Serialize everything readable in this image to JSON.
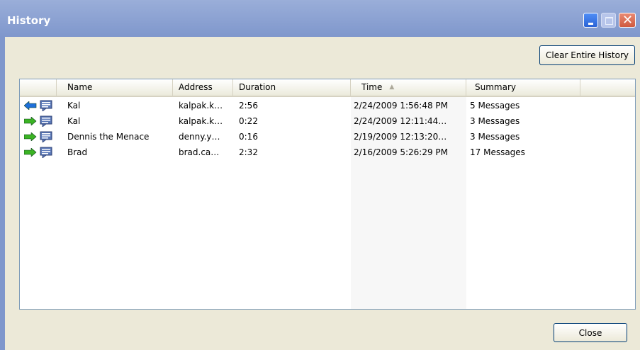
{
  "window": {
    "title": "History"
  },
  "toolbar": {
    "clear_label": "Clear Entire History"
  },
  "table": {
    "columns": [
      "Name",
      "Address",
      "Duration",
      "Time",
      "Summary"
    ],
    "sort_column": "Time",
    "rows": [
      {
        "direction": "incoming",
        "direction_icon": "blue-left-arrow-icon",
        "name": "Kal",
        "address": "kalpak.k…",
        "duration": "2:56",
        "time": "2/24/2009 1:56:48 PM",
        "summary": "5 Messages"
      },
      {
        "direction": "outgoing",
        "direction_icon": "green-right-arrow-icon",
        "name": "Kal",
        "address": "kalpak.k…",
        "duration": "0:22",
        "time": "2/24/2009 12:11:44…",
        "summary": "3 Messages"
      },
      {
        "direction": "outgoing",
        "direction_icon": "green-right-arrow-icon",
        "name": "Dennis the Menace",
        "address": "denny.y…",
        "duration": "0:16",
        "time": "2/19/2009 12:13:20…",
        "summary": "3 Messages"
      },
      {
        "direction": "outgoing",
        "direction_icon": "green-right-arrow-icon",
        "name": "Brad",
        "address": "brad.ca…",
        "duration": "2:32",
        "time": "2/16/2009 5:26:29 PM",
        "summary": "17 Messages"
      }
    ]
  },
  "footer": {
    "close_label": "Close"
  },
  "colors": {
    "titlebar": "#8aa0d4",
    "incoming_arrow": "#1e6fd9",
    "outgoing_arrow": "#3bb324",
    "window_bg": "#ece9d8"
  }
}
